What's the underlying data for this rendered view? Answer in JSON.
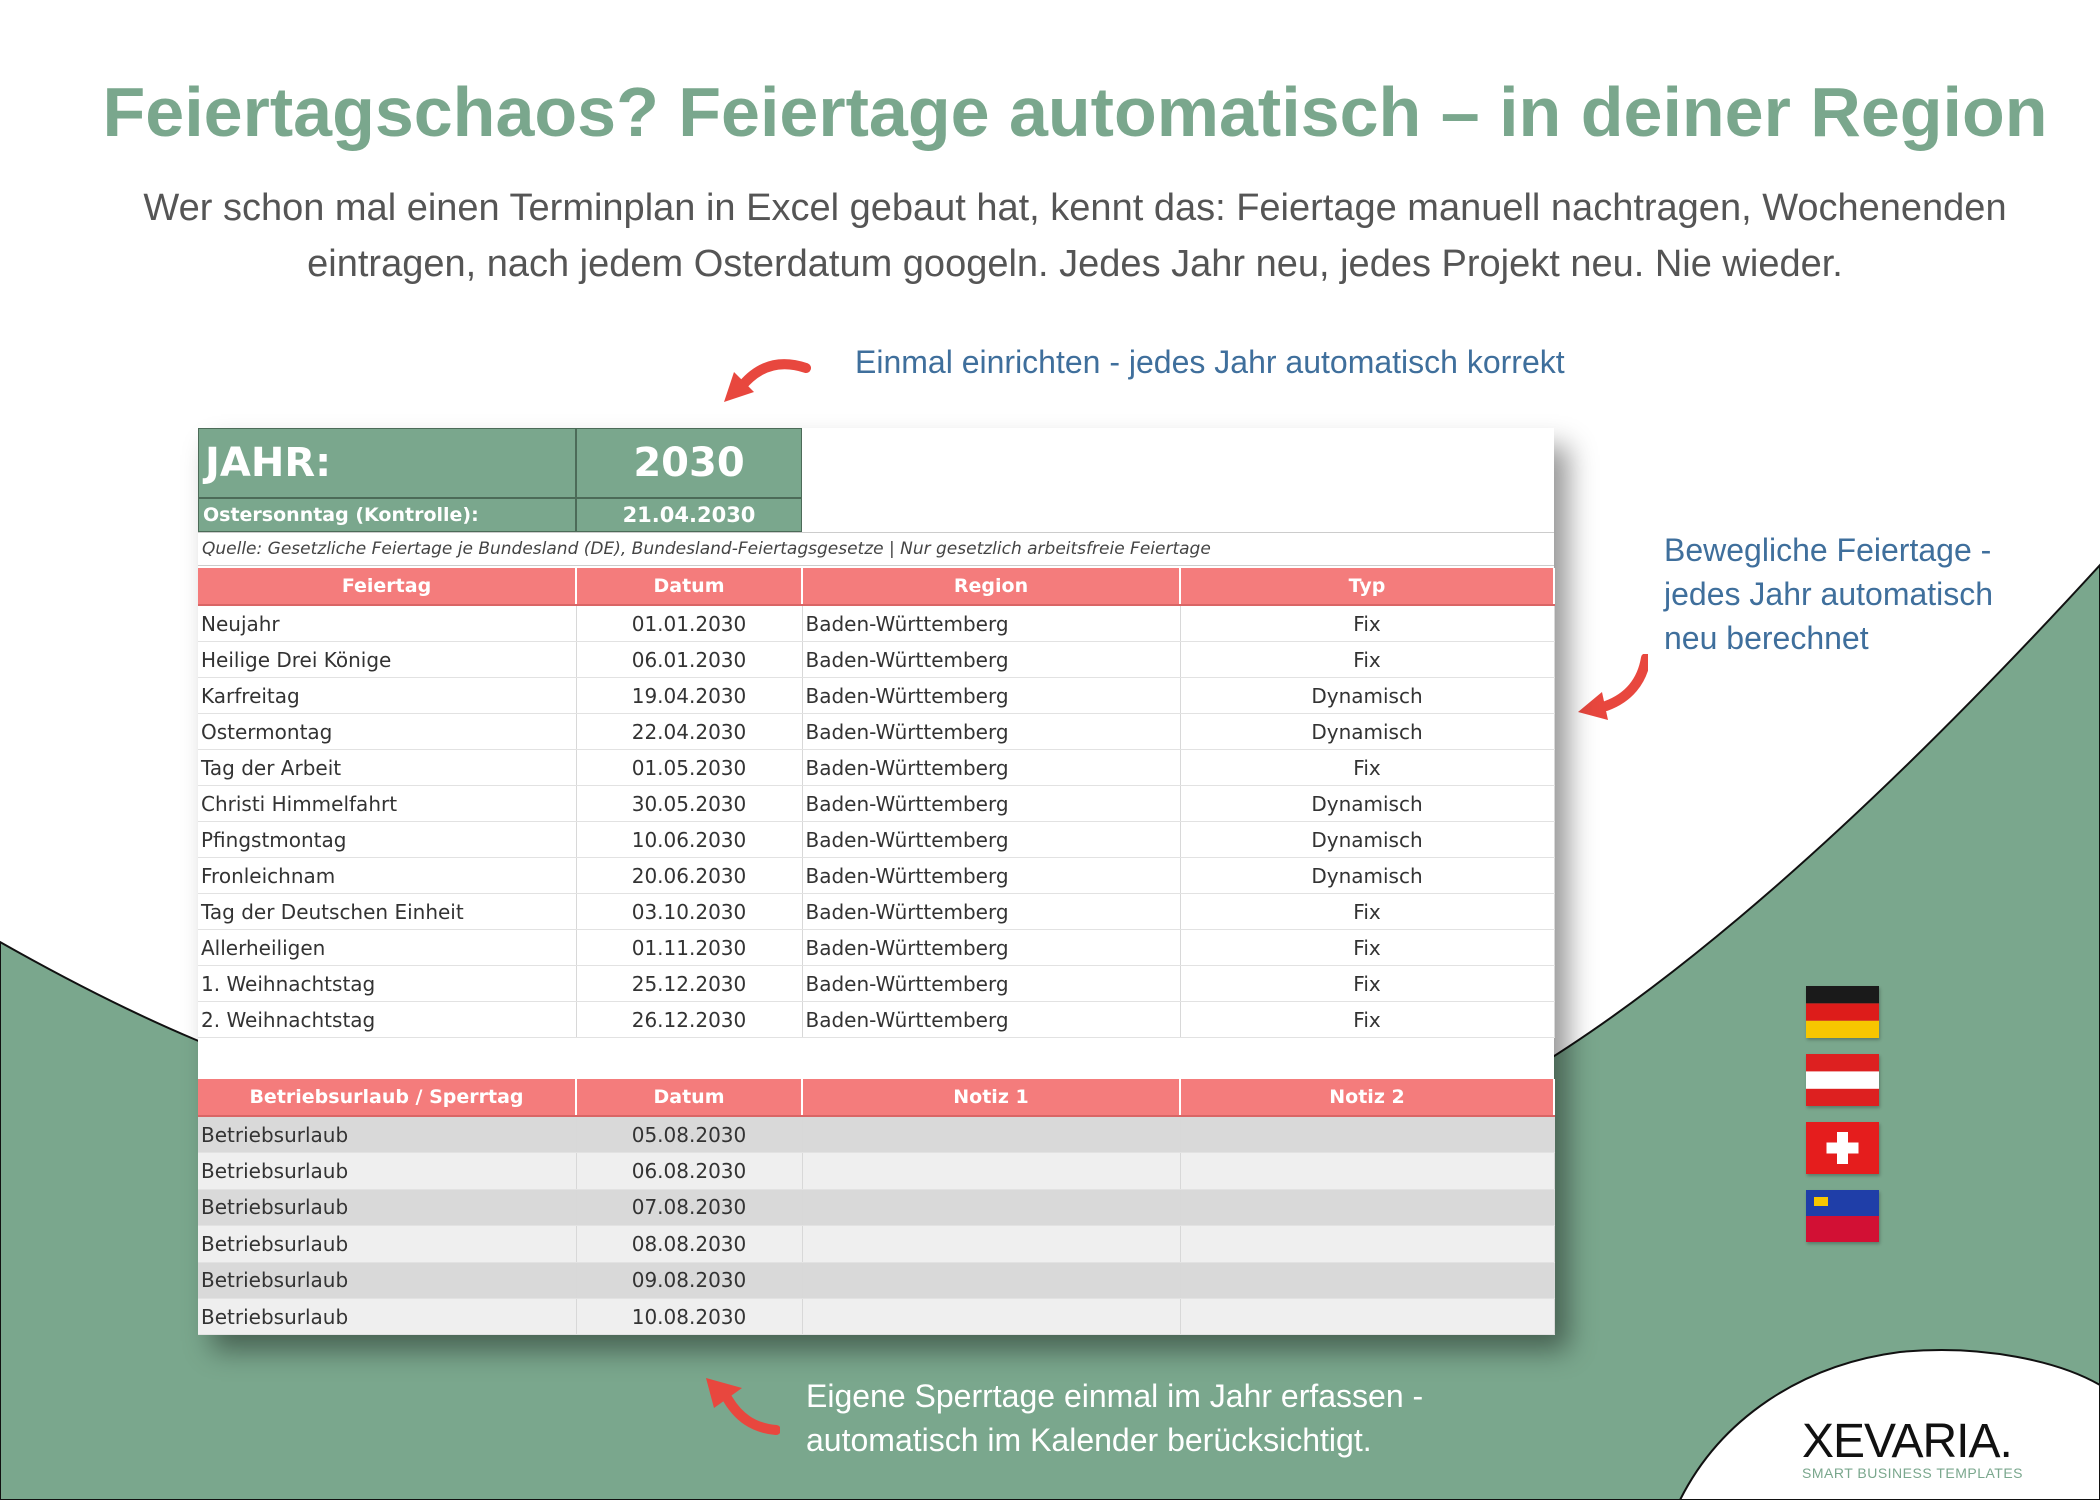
{
  "colors": {
    "green": "#7aa78d",
    "coral": "#f47c7c",
    "blue_text": "#3f6f9c",
    "fix": "#3f8f3f",
    "dynamic": "#d22020"
  },
  "hero": {
    "headline": "Feiertagschaos? Feiertage automatisch – in deiner Region",
    "subline": "Wer schon mal einen Terminplan in Excel gebaut hat, kennt das: Feiertage manuell nachtragen, Wochenenden eintragen, nach jedem Osterdatum googeln. Jedes Jahr neu, jedes Projekt neu. Nie wieder."
  },
  "callouts": {
    "top": "Einmal einrichten - jedes Jahr automatisch korrekt",
    "right": "Bewegliche Feiertage - jedes Jahr automatisch neu berechnet",
    "bottom": "Eigene Sperrtage einmal im Jahr erfassen - automatisch im Kalender berücksichtigt."
  },
  "sheet": {
    "year_label": "JAHR:",
    "year_value": "2030",
    "easter_label": "Ostersonntag (Kontrolle):",
    "easter_value": "21.04.2030",
    "source": "Quelle: Gesetzliche Feiertage je Bundesland (DE), Bundesland-Feiertagsgesetze | Nur gesetzlich arbeitsfreie Feiertage",
    "holiday_headers": [
      "Feiertag",
      "Datum",
      "Region",
      "Typ"
    ],
    "holidays": [
      {
        "name": "Neujahr",
        "date": "01.01.2030",
        "region": "Baden-Württemberg",
        "type": "Fix"
      },
      {
        "name": "Heilige Drei Könige",
        "date": "06.01.2030",
        "region": "Baden-Württemberg",
        "type": "Fix"
      },
      {
        "name": "Karfreitag",
        "date": "19.04.2030",
        "region": "Baden-Württemberg",
        "type": "Dynamisch"
      },
      {
        "name": "Ostermontag",
        "date": "22.04.2030",
        "region": "Baden-Württemberg",
        "type": "Dynamisch"
      },
      {
        "name": "Tag der Arbeit",
        "date": "01.05.2030",
        "region": "Baden-Württemberg",
        "type": "Fix"
      },
      {
        "name": "Christi Himmelfahrt",
        "date": "30.05.2030",
        "region": "Baden-Württemberg",
        "type": "Dynamisch"
      },
      {
        "name": "Pfingstmontag",
        "date": "10.06.2030",
        "region": "Baden-Württemberg",
        "type": "Dynamisch"
      },
      {
        "name": "Fronleichnam",
        "date": "20.06.2030",
        "region": "Baden-Württemberg",
        "type": "Dynamisch"
      },
      {
        "name": "Tag der Deutschen Einheit",
        "date": "03.10.2030",
        "region": "Baden-Württemberg",
        "type": "Fix"
      },
      {
        "name": "Allerheiligen",
        "date": "01.11.2030",
        "region": "Baden-Württemberg",
        "type": "Fix"
      },
      {
        "name": "1. Weihnachtstag",
        "date": "25.12.2030",
        "region": "Baden-Württemberg",
        "type": "Fix"
      },
      {
        "name": "2. Weihnachtstag",
        "date": "26.12.2030",
        "region": "Baden-Württemberg",
        "type": "Fix"
      }
    ],
    "closure_headers": [
      "Betriebsurlaub / Sperrtag",
      "Datum",
      "Notiz 1",
      "Notiz 2"
    ],
    "closures": [
      {
        "name": "Betriebsurlaub",
        "date": "05.08.2030",
        "note1": "",
        "note2": ""
      },
      {
        "name": "Betriebsurlaub",
        "date": "06.08.2030",
        "note1": "",
        "note2": ""
      },
      {
        "name": "Betriebsurlaub",
        "date": "07.08.2030",
        "note1": "",
        "note2": ""
      },
      {
        "name": "Betriebsurlaub",
        "date": "08.08.2030",
        "note1": "",
        "note2": ""
      },
      {
        "name": "Betriebsurlaub",
        "date": "09.08.2030",
        "note1": "",
        "note2": ""
      },
      {
        "name": "Betriebsurlaub",
        "date": "10.08.2030",
        "note1": "",
        "note2": ""
      }
    ]
  },
  "flags": [
    {
      "icon": "flag-germany-icon"
    },
    {
      "icon": "flag-austria-icon"
    },
    {
      "icon": "flag-switzerland-icon"
    },
    {
      "icon": "flag-liechtenstein-icon"
    }
  ],
  "brand": {
    "name": "XEVARIA.",
    "tagline": "SMART BUSINESS TEMPLATES"
  }
}
